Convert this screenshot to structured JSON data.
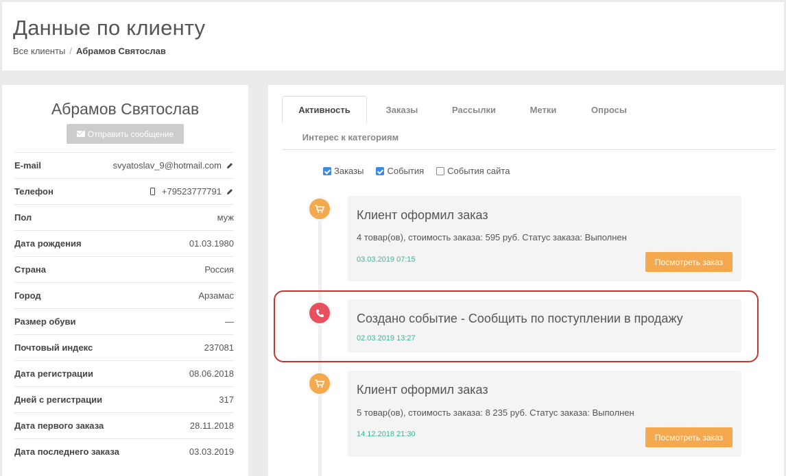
{
  "header": {
    "title": "Данные по клиенту",
    "breadcrumb_root": "Все клиенты",
    "breadcrumb_sep": "/",
    "breadcrumb_current": "Абрамов Святослав"
  },
  "client": {
    "name": "Абрамов Святослав",
    "send_button": "Отправить сообщение",
    "fields": [
      {
        "label": "E-mail",
        "value": "svyatoslav_9@hotmail.com"
      },
      {
        "label": "Телефон",
        "value": "+79523777791"
      },
      {
        "label": "Пол",
        "value": "муж"
      },
      {
        "label": "Дата рождения",
        "value": "01.03.1980"
      },
      {
        "label": "Страна",
        "value": "Россия"
      },
      {
        "label": "Город",
        "value": "Арзамас"
      },
      {
        "label": "Размер обуви",
        "value": "—"
      },
      {
        "label": "Почтовый индекс",
        "value": "237081"
      },
      {
        "label": "Дата регистрации",
        "value": "08.06.2018"
      },
      {
        "label": "Дней с регистрации",
        "value": "317"
      },
      {
        "label": "Дата первого заказа",
        "value": "28.11.2018"
      },
      {
        "label": "Дата последнего заказа",
        "value": "03.03.2019"
      }
    ]
  },
  "tabs": [
    "Активность",
    "Заказы",
    "Рассылки",
    "Метки",
    "Опросы",
    "Интерес к категориям"
  ],
  "filters": [
    {
      "label": "Заказы",
      "checked": true
    },
    {
      "label": "События",
      "checked": true
    },
    {
      "label": "События сайта",
      "checked": false
    }
  ],
  "events": [
    {
      "title": "Клиент оформил заказ",
      "desc": "4 товар(ов), стоимость заказа: 595 руб. Статус заказа: Выполнен",
      "time": "03.03.2019 07:15",
      "button": "Посмотреть заказ",
      "icon": "cart-icon"
    },
    {
      "title": "Создано событие - Сообщить по поступлении в продажу",
      "time": "02.03.2019 13:27",
      "icon": "phone-icon"
    },
    {
      "title": "Клиент оформил заказ",
      "desc": "5 товар(ов), стоимость заказа: 8 235 руб. Статус заказа: Выполнен",
      "time": "14.12.2018 21:30",
      "button": "Посмотреть заказ",
      "icon": "cart-icon"
    }
  ],
  "colors": {
    "accent": "#f5a94e",
    "event_red": "#e84f5f",
    "time_green": "#3bb39a",
    "checkbox_blue": "#3b8be0",
    "highlight": "#c8322f"
  }
}
